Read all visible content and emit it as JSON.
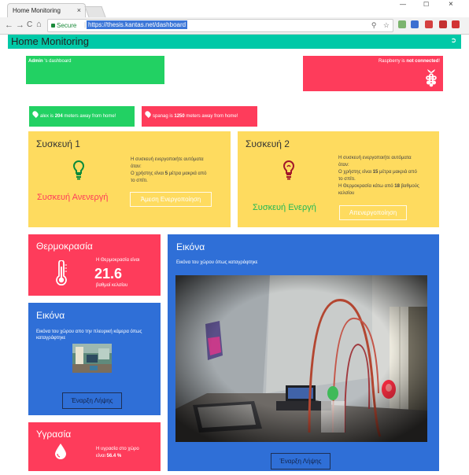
{
  "browser": {
    "tab_title": "Home Monitoring",
    "tab_close": "×",
    "back": "←",
    "forward": "→",
    "reload": "C",
    "home": "⌂",
    "secure_label": "Secure",
    "url": "https://thesis.kantas.net/dashboard",
    "minimize": "—",
    "maximize": "☐",
    "close": "×"
  },
  "app": {
    "title": "Home Monitoring",
    "logout_icon": "sign-out-icon"
  },
  "status": {
    "dashboard_user": "Admin",
    "dashboard_suffix": " 's dashboard",
    "raspberry_pre": "Raspberry is ",
    "raspberry_bold": "not connected",
    "raspberry_post": "!"
  },
  "locations": [
    {
      "user": "alex",
      "mid": " is ",
      "distance": "204",
      "suffix": " meters away from home!"
    },
    {
      "user": "spanag",
      "mid": " is ",
      "distance": "1250",
      "suffix": " meters away from home!"
    }
  ],
  "devices": [
    {
      "title": "Συσκευή 1",
      "desc_line1": "Η συσκευή ενεργοποιήτε αυτόματα",
      "desc_line2": "όταν:",
      "desc_line3a": "Ο χρήστης είναι ",
      "desc_line3b": "5",
      "desc_line3c": " μέτρα μακριά από",
      "desc_line4": "το σπίτι.",
      "status": "Συσκευή Ανενεργή",
      "button": "Άμεση Ενεργοποίηση",
      "status_color": "#fe3c5b"
    },
    {
      "title": "Συσκευή 2",
      "desc_line1": "Η συσκευή ενεργοποιήτε αυτόματα",
      "desc_line2": "όταν:",
      "desc_line3a": "Ο χρήστης είναι ",
      "desc_line3b": "15",
      "desc_line3c": " μέτρα μακριά από",
      "desc_line4": "το σπίτι.",
      "desc_line5a": "Η Θερμοκρασία κάτω από ",
      "desc_line5b": "18",
      "desc_line5c": " βαθμούς",
      "desc_line6": "κελσίου",
      "status": "Συσκευή Ενεργή",
      "button": "Απενεργοποίηση",
      "status_color": "#22d163"
    }
  ],
  "temperature": {
    "title": "Θερμοκρασία",
    "label": "Η Θερμοκρασία είναι",
    "value": "21.6",
    "unit": "βαθμοί κελσίου"
  },
  "side_camera": {
    "title": "Εικόνα",
    "desc": "Εικόνα του χώρου απο την πλευρική κάμερα όπως καταγράφτηκε",
    "button": "Έναρξη Λήψης"
  },
  "main_camera": {
    "title": "Εικόνα",
    "desc": "Εικόνα του χώρου όπως καταγράφτηκε",
    "button": "Έναρξη Λήψης"
  },
  "humidity": {
    "title": "Υγρασία",
    "label": "Η υγρασία στο χώρο",
    "value_pre": "είναι ",
    "value": "56.4 %"
  },
  "colors": {
    "accent": "#00c9a7",
    "green": "#22d163",
    "red": "#fe3c5b",
    "yellow": "#fedb5f",
    "blue": "#2f6fd7"
  }
}
